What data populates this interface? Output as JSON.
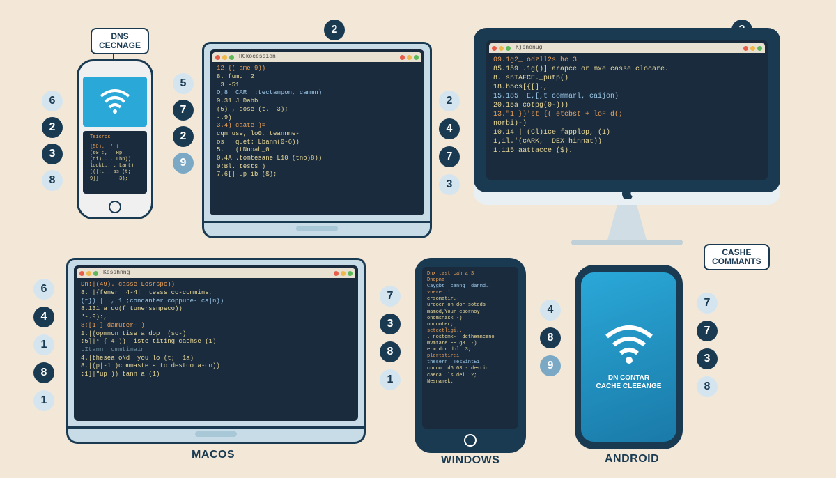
{
  "labels": {
    "dns_cecnage": "DNS\nCECNAGE",
    "cashe_commants": "CASHE\nCOMMANTS",
    "dn_contar": "DN CONTAR\nCACHE CLEEANGE",
    "macos": "MACOS",
    "windows": "WINDOWS",
    "android": "ANDROID"
  },
  "terminals": {
    "top_laptop": {
      "title": "HCkocession",
      "lines": [
        "12.{( ame 9))",
        "8. fumg  2",
        " 3.-51",
        "O,8  CAR  :tectampon, cammn)",
        "9.31 J Dabb",
        "(5) , dose (t.  3);",
        "-.9)",
        "3.4) caate )=",
        "cqnnuse, lo0, teannne-",
        "os   quet: Lbann(0-6))",
        "5.   (tNnoah_0",
        "0.4A .tomtesane L10 (tno)8))",
        "0:Bl. tests )",
        "7.6[| up ib ($);"
      ]
    },
    "imac": {
      "title": "Kjenonug",
      "lines": [
        "09.1g2_ odzll2s he 3",
        "85.159 .1g()] arapce or mxe casse clocare.",
        "8. snTAFCE._putp()",
        "18.b5cs[{[].,",
        "15.185  E,[,t commarl, caijon)",
        "20.15a cotpg(0-)))",
        "",
        "13.\"1 })'st {( etcbst + loF d(;",
        "norbi)-)",
        "10.14 | (Cl)1ce fapplop, (1)",
        "1,1l.'(cARK,  DEX hinnat))",
        "1.115 aattacce ($)."
      ]
    },
    "bottom_laptop": {
      "title": "Kesshnng",
      "lines": [
        "Dn:|(49). casse Losrspc))",
        "8. |{fener  4-4|  tesss co-commins,",
        "(t}) | |, 1 ;condanter coppupe- ca|n))",
        "8.131 a do(f tunerssnpeco))",
        "\"-.9):,",
        "8:[1-] damuter- )",
        "1.|{opmnon tise a dop  (so-)",
        ":5]|* { 4 ))  iste titing cachse (1)",
        "LItann  ommtimain",
        "4.|thesea oNd  you lo (t;  1a)",
        "8.|(p|-1 )commaste a to destoo a-co))",
        ":1]|\"up )) tann a (1)"
      ]
    },
    "windows_phone": {
      "title": "Dnx tast cah a S\nDnopna",
      "lines": [
        "Caygbt  canng  danmd..",
        "vnere  1",
        "crsomatir.-",
        "urooer on dor sotcds",
        "mamod,Your cpornoy",
        "onomsnask -)",
        "uncomter;",
        "setcetligi..",
        ". nostomk-  dcthemnceno",
        "mvmtare EE g8  -)",
        "erm dor dol  3;",
        "plertstir:i",
        "thesern  TesSintE1",
        "cnnon  d6 08 - destic",
        "caeca  ls del  2;",
        "Nesnamek."
      ]
    },
    "ios_phone": {
      "title": "Teicros",
      "lines": [
        "{50).  ' (",
        "(60 :,   Hp",
        "(di).. . Lbn))",
        "lcokt.. . Lant)",
        "((|:. . ss (t;",
        "9]]       3);"
      ]
    }
  },
  "badges": {
    "top_row": [
      "2",
      "2"
    ],
    "col_left_top": [
      "6",
      "2",
      "3",
      "8"
    ],
    "col_mid_top": [
      "5",
      "7",
      "2",
      "9"
    ],
    "col_right_top": [
      "2",
      "4",
      "7",
      "3"
    ],
    "bottom_left": [
      "6",
      "4",
      "1",
      "8",
      "1"
    ],
    "bottom_mid": [
      "7",
      "3",
      "8",
      "1"
    ],
    "bottom_right1": [
      "4",
      "8",
      "9"
    ],
    "bottom_right2": [
      "7",
      "7",
      "3",
      "8"
    ]
  }
}
